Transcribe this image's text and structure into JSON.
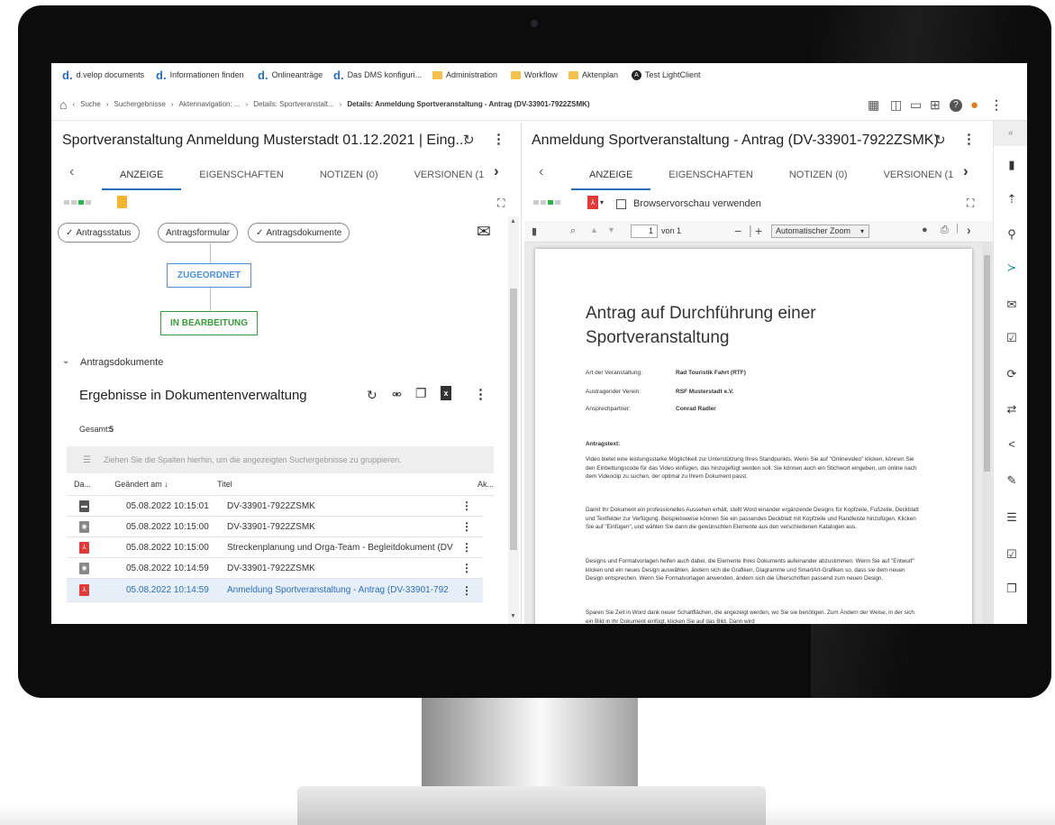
{
  "bookmarks": [
    {
      "icon": "dvelop",
      "label": "d.velop documents"
    },
    {
      "icon": "dvelop",
      "label": "Informationen finden"
    },
    {
      "icon": "dvelop",
      "label": "Onlineanträge"
    },
    {
      "icon": "dvelop",
      "label": "Das DMS konfiguri..."
    },
    {
      "icon": "folder",
      "label": "Administration"
    },
    {
      "icon": "folder",
      "label": "Workflow"
    },
    {
      "icon": "folder",
      "label": "Aktenplan"
    },
    {
      "icon": "angular",
      "label": "Test LightClient"
    }
  ],
  "bookmark_glyphs": {
    "dvelop": "d.",
    "angular": "A"
  },
  "breadcrumb": {
    "items": [
      "Suche",
      "Suchergebnisse",
      "Aktennavigation: ...",
      "Details: Sportveranstalt..."
    ],
    "current": "Details: Anmeldung Sportveranstaltung - Antrag (DV-33901-7922ZSMK)"
  },
  "left_pane": {
    "title": "Sportveranstaltung Anmeldung Musterstadt 01.12.2021 | Eing...",
    "tabs": [
      "ANZEIGE",
      "EIGENSCHAFTEN",
      "NOTIZEN (0)",
      "VERSIONEN (1"
    ],
    "active_tab": 0,
    "chips": [
      "Antragsstatus",
      "Antragsformular",
      "Antragsdokumente"
    ],
    "workflow": {
      "state1": "ZUGEORDNET",
      "state2": "IN BEARBEITUNG",
      "color1": "#4a90d9",
      "color2": "#3a9a3a"
    },
    "section_label": "Antragsdokumente",
    "results_title": "Ergebnisse in Dokumentenverwaltung",
    "total_label": "Gesamt:",
    "total_value": "5",
    "group_hint": "Ziehen Sie die Spalten hierhin, um die angezeigten Suchergebnisse zu gruppieren.",
    "columns": {
      "type": "Da...",
      "changed": "Geändert am",
      "title": "Titel",
      "actions": "Ak..."
    },
    "rows": [
      {
        "icon": "archive",
        "date": "05.08.2022 10:15:01",
        "title": "DV-33901-7922ZSMK"
      },
      {
        "icon": "gray",
        "date": "05.08.2022 10:15:00",
        "title": "DV-33901-7922ZSMK"
      },
      {
        "icon": "pdf",
        "date": "05.08.2022 10:15:00",
        "title": "Streckenplanung und Orga-Team - Begleitdokument (DV"
      },
      {
        "icon": "gray",
        "date": "05.08.2022 10:14:59",
        "title": "DV-33901-7922ZSMK"
      },
      {
        "icon": "pdf",
        "date": "05.08.2022 10:14:59",
        "title": "Anmeldung Sportveranstaltung - Antrag (DV-33901-792"
      }
    ],
    "selected_row": 4
  },
  "right_pane": {
    "title": "Anmeldung Sportveranstaltung - Antrag (DV-33901-7922ZSMK)",
    "tabs": [
      "ANZEIGE",
      "EIGENSCHAFTEN",
      "NOTIZEN (0)",
      "VERSIONEN (1"
    ],
    "active_tab": 0,
    "browser_preview_label": "Browservorschau verwenden",
    "pdf_toolbar": {
      "page": "1",
      "of": "von 1",
      "zoom": "Automatischer Zoom"
    },
    "document": {
      "heading": "Antrag auf Durchführung einer Sportveranstaltung",
      "fields": [
        {
          "label": "Art der Veranstaltung:",
          "value": "Rad Touristik Fahrt (RTF)"
        },
        {
          "label": "Austragender Verein:",
          "value": "RSF Musterstadt e.V."
        },
        {
          "label": "Ansprechpartner:",
          "value": "Conrad Radler"
        }
      ],
      "text_label": "Antragstext:",
      "paragraphs": [
        "Video bietet eine leistungsstarke Möglichkeit zur Unterstützung Ihres Standpunkts. Wenn Sie auf \"Onlinevideo\" klicken, können Sie den Einbettungscode für das Video einfügen, das hinzugefügt werden soll. Sie können auch ein Stichwort eingeben, um online nach dem Videoclip zu suchen, der optimal zu Ihrem Dokument passt.",
        "Damit Ihr Dokument ein professionelles Aussehen erhält, stellt Word einander ergänzende Designs für Kopfzeile, Fußzeile, Deckblatt und Textfelder zur Verfügung. Beispielsweise können Sie ein passendes Deckblatt mit Kopfzeile und Randleiste hinzufügen. Klicken Sie auf \"Einfügen\", und wählen Sie dann die gewünschten Elemente aus den verschiedenen Katalogen aus.",
        "Designs und Formatvorlagen helfen auch dabei, die Elemente Ihres Dokuments aufeinander abzustimmen. Wenn Sie auf \"Entwurf\" klicken und ein neues Design auswählen, ändern sich die Grafiken, Diagramme und SmartArt-Grafiken so, dass sie dem neuen Design entsprechen. Wenn Sie Formatvorlagen anwenden, ändern sich die Überschriften passend zum neuen Design.",
        "Sparen Sie Zeit in Word dank neuer Schaltflächen, die angezeigt werden, wo Sie sie benötigen. Zum Ändern der Weise, in der sich ein Bild in Ihr Dokument einfügt, klicken Sie auf das Bild. Dann wird"
      ]
    }
  },
  "colors": {
    "accent": "#2b6fb6",
    "pdf": "#e03a3a",
    "green": "#3a9a3a",
    "orange_user": "#e07b1e",
    "brand_teal": "#1a8fa8"
  }
}
